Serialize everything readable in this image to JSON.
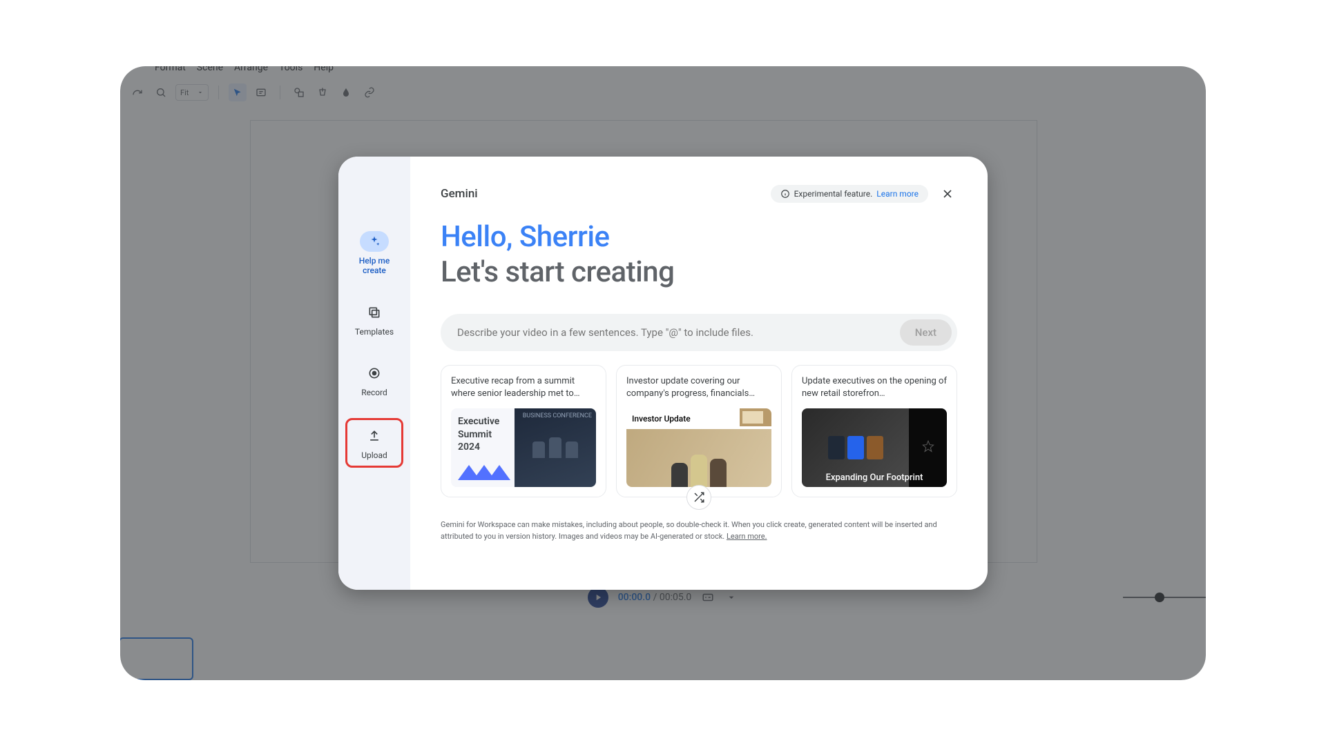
{
  "menu": {
    "format": "Format",
    "scene": "Scene",
    "arrange": "Arrange",
    "tools": "Tools",
    "help": "Help"
  },
  "playback": {
    "current": "00:00.0",
    "total": "00:05.0"
  },
  "modal": {
    "title": "Gemini",
    "experimental_label": "Experimental feature.",
    "experimental_link": "Learn more",
    "hero_line1": "Hello, Sherrie",
    "hero_line2": "Let's start creating",
    "prompt_placeholder": "Describe your video in a few sentences. Type \"@\" to include files.",
    "next_label": "Next",
    "disclaimer_text": "Gemini for Workspace can make mistakes, including about people, so double-check it. When you click create, generated content will be inserted and attributed to you in version history. Images and videos may be AI-generated or stock. ",
    "disclaimer_link": "Learn more."
  },
  "sidebar": {
    "help_me_create": "Help me create",
    "templates": "Templates",
    "record": "Record",
    "upload": "Upload"
  },
  "cards": [
    {
      "text": "Executive recap from a summit where senior leadership met to…",
      "thumb_title": "Executive Summit 2024",
      "thumb_corner": "BUSINESS CONFERENCE"
    },
    {
      "text": "Investor update covering our company's progress, financials…",
      "thumb_title": "Investor Update"
    },
    {
      "text": "Update executives on the opening of new retail storefron…",
      "thumb_caption": "Expanding Our Footprint"
    }
  ]
}
